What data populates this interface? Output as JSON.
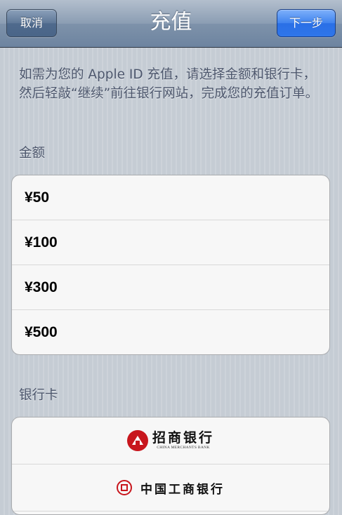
{
  "nav": {
    "title": "充值",
    "cancel_label": "取消",
    "next_label": "下一步"
  },
  "intro_text": "如需为您的 Apple ID 充值，请选择金额和银行卡，然后轻敲“继续”前往银行网站，完成您的充值订单。",
  "amount_section": {
    "header": "金额",
    "options": [
      "¥50",
      "¥100",
      "¥300",
      "¥500"
    ]
  },
  "bank_section": {
    "header": "银行卡",
    "banks": [
      {
        "name": "招商银行",
        "name_en": "CHINA MERCHANTS BANK",
        "icon": "cmb-logo-icon"
      },
      {
        "name": "中国工商银行",
        "icon": "icbc-logo-icon"
      }
    ]
  },
  "colors": {
    "nav_gradient_top": "#b3bfcd",
    "nav_gradient_bottom": "#6d84a0",
    "next_button": "#2f76ea",
    "background": "#cbd2d8",
    "section_text": "#4c566c",
    "bank_red": "#c8161d"
  }
}
